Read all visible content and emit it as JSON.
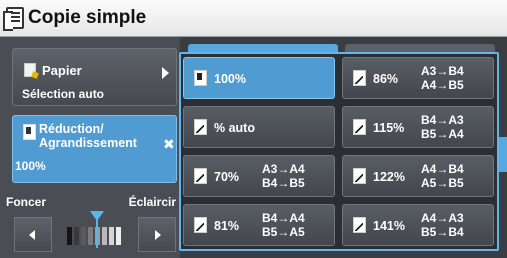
{
  "window": {
    "title": "Copie simple"
  },
  "left": {
    "paper": {
      "label": "Papier",
      "value": "Sélection auto"
    },
    "reduce": {
      "label": "Réduction/ Agrandissement",
      "value": "100%"
    },
    "density": {
      "darker": "Foncer",
      "lighter": "Éclaircir"
    }
  },
  "ratios": [
    {
      "pct": "100%",
      "sizes": [
        "",
        ""
      ],
      "selected": true
    },
    {
      "pct": "86%",
      "sizes": [
        "A3→B4",
        "A4→B5"
      ]
    },
    {
      "pct": "% auto",
      "sizes": [
        "",
        ""
      ]
    },
    {
      "pct": "115%",
      "sizes": [
        "B4→A3",
        "B5→A4"
      ]
    },
    {
      "pct": "70%",
      "sizes": [
        "A3→A4",
        "B4→B5"
      ]
    },
    {
      "pct": "122%",
      "sizes": [
        "A4→B4",
        "A5→B5"
      ]
    },
    {
      "pct": "81%",
      "sizes": [
        "B4→A4",
        "B5→A5"
      ]
    },
    {
      "pct": "141%",
      "sizes": [
        "A4→A3",
        "B5→B4"
      ]
    }
  ],
  "colors": {
    "accent": "#4f9bd2",
    "highlight": "#62b4ea"
  },
  "icons": {
    "title": "copy-document-icon",
    "paper": "paper-icon",
    "reduce": "reduce-enlarge-icon"
  }
}
